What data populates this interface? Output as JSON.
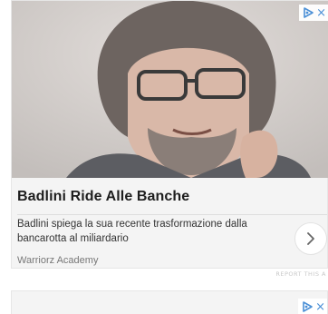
{
  "ad": {
    "title": "Badlini Ride Alle Banche",
    "description": "Badlini spiega la sua recente trasformazione dalla bancarotta al miliardario",
    "source": "Warriorz Academy",
    "report_label": "REPORT THIS A",
    "adchoices_icon": "adchoices-icon",
    "close_glyph": "×"
  },
  "colors": {
    "accent": "#4a8fd6",
    "card_bg": "#f4f4f4",
    "title": "#1e1e1e"
  }
}
